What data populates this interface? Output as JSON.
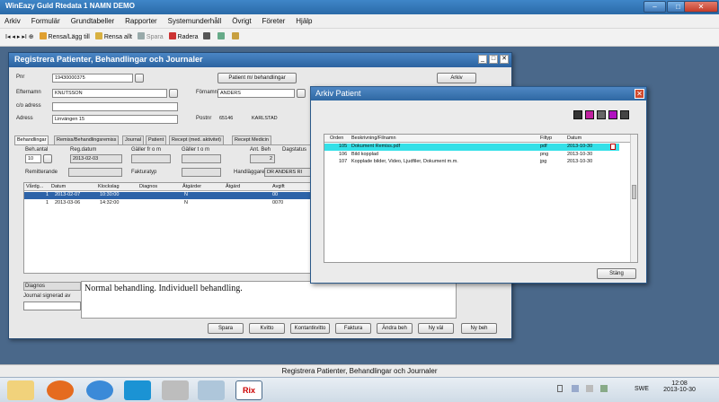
{
  "app": {
    "title": "WinEazy Guld Rtedata  1 NAMN DEMO",
    "buttons": [
      "–",
      "□",
      "✕"
    ]
  },
  "menu": [
    "Arkiv",
    "Formulär",
    "Grundtabeller",
    "Rapporter",
    "Systemunderhåll",
    "Övrigt",
    "Företer",
    "Hjälp"
  ],
  "toolbar": {
    "nav": "I◂ ◂ ▸ ▸I  ⊕",
    "items": [
      "Rensa/Lägg till",
      "Rensa allt",
      "Spara",
      "Radera"
    ]
  },
  "dialog": {
    "title": "Registrera Patienter, Behandlingar och Journaler",
    "labels": {
      "pnr": "Pnr",
      "efternamn": "Efternamn",
      "coadress": "c/o adress",
      "adress": "Adress",
      "fornamn": "Förnamn",
      "postnr": "Postnr"
    },
    "values": {
      "pnr": "19430000375",
      "efternamn": "KNUTSSON",
      "fornamn": "ANDERS",
      "adress": "Linvängen 15",
      "postnr": "65146",
      "ort": "KARLSTAD"
    },
    "buttons": {
      "patient_behandling": "Patient m/ behandlingar",
      "arkiv": "Arkiv"
    },
    "tabs": [
      "Behandlingar",
      "Remiss/Behandlingsremiss",
      "Journal",
      "Patient",
      "Recept (med. aktivitet)",
      "Recept Medicin"
    ],
    "fields": {
      "beh_antal": "Beh.antal",
      "beh_antal_val": "10",
      "reg_datum": "Reg.datum",
      "reg_datum_val": "2013-02-03",
      "galler_from": "Gäller fr o m",
      "galler_tom": "Gäller t o m",
      "ant_beh": "Ant. Beh",
      "ant_beh_val": "2",
      "dagstatus": "Dagstatus",
      "remitterande": "Remitterande",
      "fakturatyp": "Fakturatyp",
      "handlaggare": "Handläggare",
      "handlaggare_val": "DR ANDERS RI"
    },
    "grid": {
      "headers": [
        "Vårdg...",
        "Datum",
        "Klockslag",
        "Diagnos",
        "Åtgärder",
        "Åtgärd",
        "Avgift"
      ],
      "rows": [
        [
          "1",
          "2013-02-07",
          "10:30:00",
          "",
          "N",
          "",
          "00"
        ],
        [
          "1",
          "2013-03-06",
          "14:32:00",
          "",
          "N",
          "",
          "0070"
        ]
      ]
    },
    "diagnos_label": "Diagnos",
    "journalsignatur_label": "Journal signerad av",
    "journal_text": "Normal behandling. Individuell behandling.",
    "bottom_buttons": [
      "Spara",
      "Kvitto",
      "Kontantkvitto",
      "Faktura",
      "Ändra beh",
      "Ny väl",
      "Ny beh"
    ]
  },
  "archive": {
    "title": "Arkiv Patient",
    "headers": [
      "Orden",
      "Beskrivning/Filnamn",
      "Filtyp",
      "Datum"
    ],
    "rows": [
      [
        "105",
        "Dokument Remiss.pdf",
        "pdf",
        "2013-10-30"
      ],
      [
        "106",
        "Bild kopplad",
        "png",
        "2013-10-30"
      ],
      [
        "107",
        "Kopplade bilder, Video, Ljudfiler, Dokument m.m.",
        "jpg",
        "2013-10-30"
      ]
    ],
    "close_button": "Stäng"
  },
  "statusbar": "Registrera Patienter, Behandlingar och Journaler",
  "taskbar": {
    "time": "12:08",
    "date": "2013-10-30",
    "lang": "SWE"
  },
  "colors": {
    "title": "#2a6aa8",
    "selected_row": "#2d63a8",
    "archive_highlight": "#34e0e8"
  }
}
